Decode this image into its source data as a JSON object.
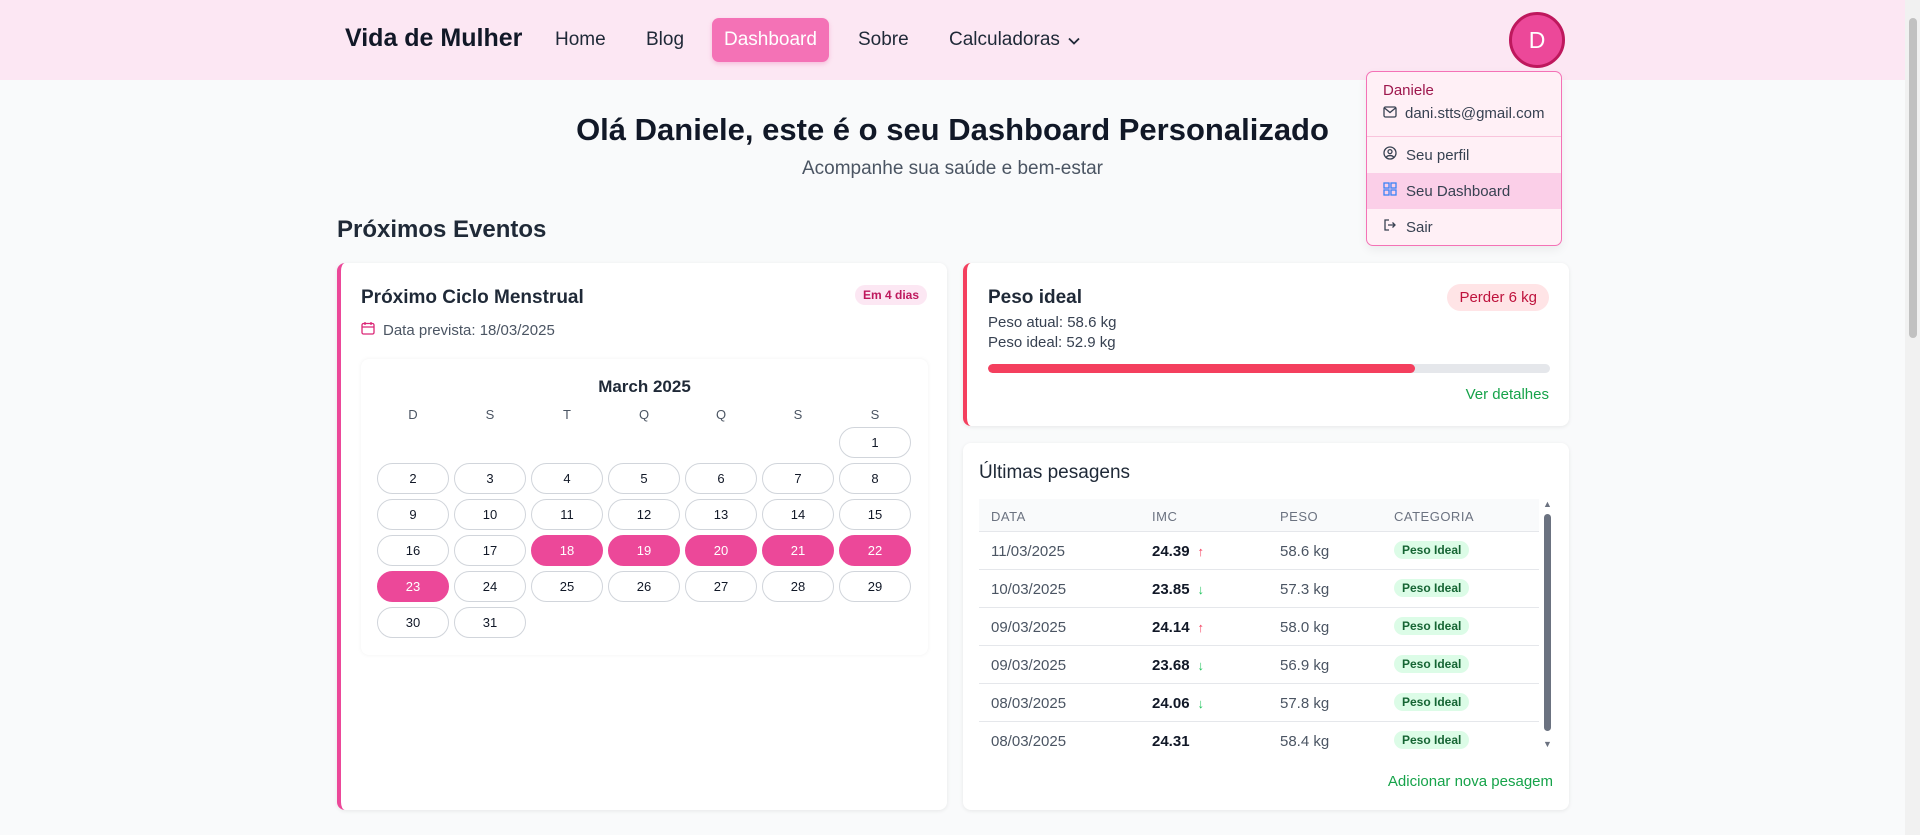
{
  "header": {
    "brand": "Vida de Mulher",
    "nav": [
      {
        "label": "Home",
        "active": false
      },
      {
        "label": "Blog",
        "active": false
      },
      {
        "label": "Dashboard",
        "active": true
      },
      {
        "label": "Sobre",
        "active": false
      },
      {
        "label": "Calculadoras",
        "active": false,
        "icon": "chevron-down-icon"
      }
    ],
    "avatar_initial": "D"
  },
  "user_menu": {
    "name": "Daniele",
    "email": "dani.stts@gmail.com",
    "items": [
      {
        "label": "Seu perfil",
        "icon": "user-circle-icon",
        "active": false
      },
      {
        "label": "Seu Dashboard",
        "icon": "grid-icon",
        "active": true
      },
      {
        "label": "Sair",
        "icon": "logout-icon",
        "active": false
      }
    ]
  },
  "hero": {
    "title": "Olá Daniele, este é o seu Dashboard Personalizado",
    "subtitle": "Acompanhe sua saúde e bem-estar"
  },
  "section_title": "Próximos Eventos",
  "cycle": {
    "title": "Próximo Ciclo Menstrual",
    "badge": "Em 4 dias",
    "date_text": "Data prevista: 18/03/2025",
    "calendar": {
      "month": "March 2025",
      "weekdays": [
        "D",
        "S",
        "T",
        "Q",
        "Q",
        "S",
        "S"
      ],
      "first_weekday_index": 6,
      "days_in_month": 31,
      "highlighted": [
        18,
        19,
        20,
        21,
        22,
        23
      ]
    }
  },
  "weight": {
    "title": "Peso ideal",
    "badge": "Perder 6 kg",
    "current": "Peso atual: 58.6 kg",
    "ideal": "Peso ideal: 52.9 kg",
    "progress": 0.76,
    "link": "Ver detalhes"
  },
  "weighings": {
    "title": "Últimas pesagens",
    "columns": [
      "DATA",
      "IMC",
      "PESO",
      "CATEGORIA"
    ],
    "rows": [
      {
        "date": "11/03/2025",
        "imc": "24.39",
        "trend": "up",
        "peso": "58.6 kg",
        "categoria": "Peso Ideal"
      },
      {
        "date": "10/03/2025",
        "imc": "23.85",
        "trend": "down",
        "peso": "57.3 kg",
        "categoria": "Peso Ideal"
      },
      {
        "date": "09/03/2025",
        "imc": "24.14",
        "trend": "up",
        "peso": "58.0 kg",
        "categoria": "Peso Ideal"
      },
      {
        "date": "09/03/2025",
        "imc": "23.68",
        "trend": "down",
        "peso": "56.9 kg",
        "categoria": "Peso Ideal"
      },
      {
        "date": "08/03/2025",
        "imc": "24.06",
        "trend": "down",
        "peso": "57.8 kg",
        "categoria": "Peso Ideal"
      },
      {
        "date": "08/03/2025",
        "imc": "24.31",
        "trend": "none",
        "peso": "58.4 kg",
        "categoria": "Peso Ideal"
      }
    ],
    "link": "Adicionar nova pesagem"
  },
  "colors": {
    "accent": "#ec4899",
    "header_bg": "#fce7f3",
    "weight_bar": "#f43f5e",
    "link_green": "#16a34a"
  }
}
